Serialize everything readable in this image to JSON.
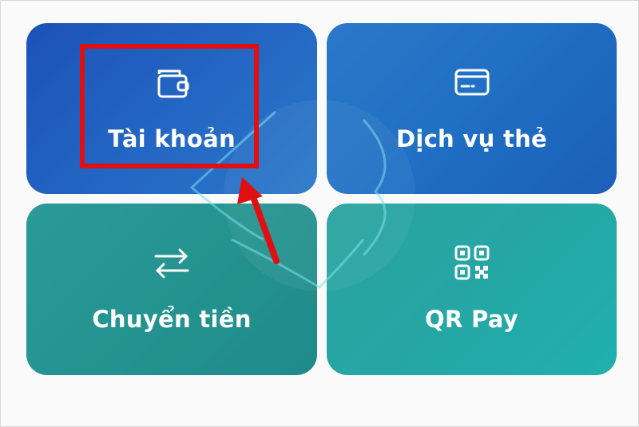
{
  "tiles": {
    "account": {
      "label": "Tài khoản",
      "icon": "wallet-icon"
    },
    "card_service": {
      "label": "Dịch vụ thẻ",
      "icon": "credit-card-icon"
    },
    "transfer": {
      "label": "Chuyển tiền",
      "icon": "transfer-arrows-icon"
    },
    "qr_pay": {
      "label": "QR Pay",
      "icon": "qr-code-icon"
    }
  },
  "colors": {
    "top_tiles": "#1f62c0",
    "bottom_tiles": "#23a09d",
    "highlight": "#e01010"
  }
}
